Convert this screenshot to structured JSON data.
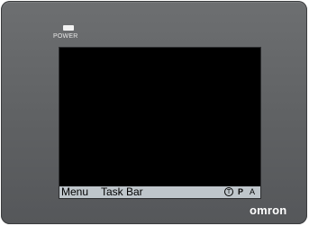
{
  "device": {
    "power_label": "POWER",
    "brand": "omron",
    "colors": {
      "bezel": "#606264",
      "screen": "#000000",
      "taskbar": "#bfc6cb",
      "power_led": "#f2f2f2"
    }
  },
  "taskbar": {
    "menu_label": "Menu",
    "taskbar_label": "Task Bar",
    "icons": {
      "t_icon": "T",
      "p_icon": "P",
      "a_icon": "A"
    }
  }
}
